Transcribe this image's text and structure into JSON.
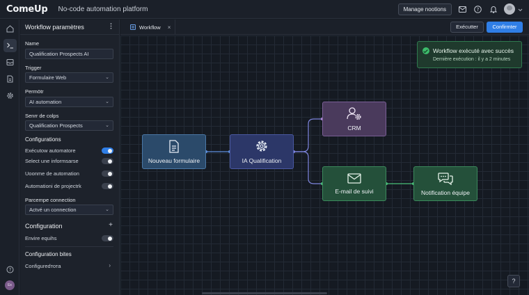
{
  "app": {
    "brand": "ComeUp",
    "tagline": "No-code automation platform",
    "manage_label": "Manage nootions"
  },
  "topbar_icons": [
    "mail-icon",
    "help-icon",
    "bell-icon",
    "avatar"
  ],
  "rail": {
    "avatar_initials": "Ex"
  },
  "panel": {
    "title": "Workflow paramètres",
    "name_label": "Name",
    "name_value": "Qualification Prospects AI",
    "trigger_label": "Trigger",
    "trigger_value": "Formulaire Web",
    "permotr_label": "Permötr",
    "permotr_value": "AI automation",
    "senrr_label": "Senrr de colps",
    "senrr_value": "Qualification Prospects",
    "configurations_title": "Configurations",
    "toggles": [
      {
        "label": "Exécutow automatore",
        "on": true
      },
      {
        "label": "Select une informsarse",
        "on": false
      },
      {
        "label": "Uoonme de automation",
        "on": false
      },
      {
        "label": "Automationi de projectrk",
        "on": false
      }
    ],
    "connection_label": "Parcempe connection",
    "connection_value": "Actvé un connection",
    "configuration_title": "Configuration",
    "envire_label": "Envire equihs",
    "config_bites_title": "Configuration bites",
    "configured_label": "Configuredтота"
  },
  "tabbar": {
    "tab_label": "Workflow",
    "execute_label": "Exécutter",
    "confirm_label": "Confirmter"
  },
  "toast": {
    "title": "Workflow exécuté avec succès",
    "subtitle": "Dernière exécution : il y a 2 minutes"
  },
  "nodes": {
    "form": "Nouveau formulaire",
    "ia": "IA Qualification",
    "crm": "CRM",
    "mail": "E-mail de suivi",
    "notif": "Notification équipe"
  },
  "help_label": "?",
  "colors": {
    "accent": "#2f7ee6",
    "success": "#3dbb6b"
  }
}
